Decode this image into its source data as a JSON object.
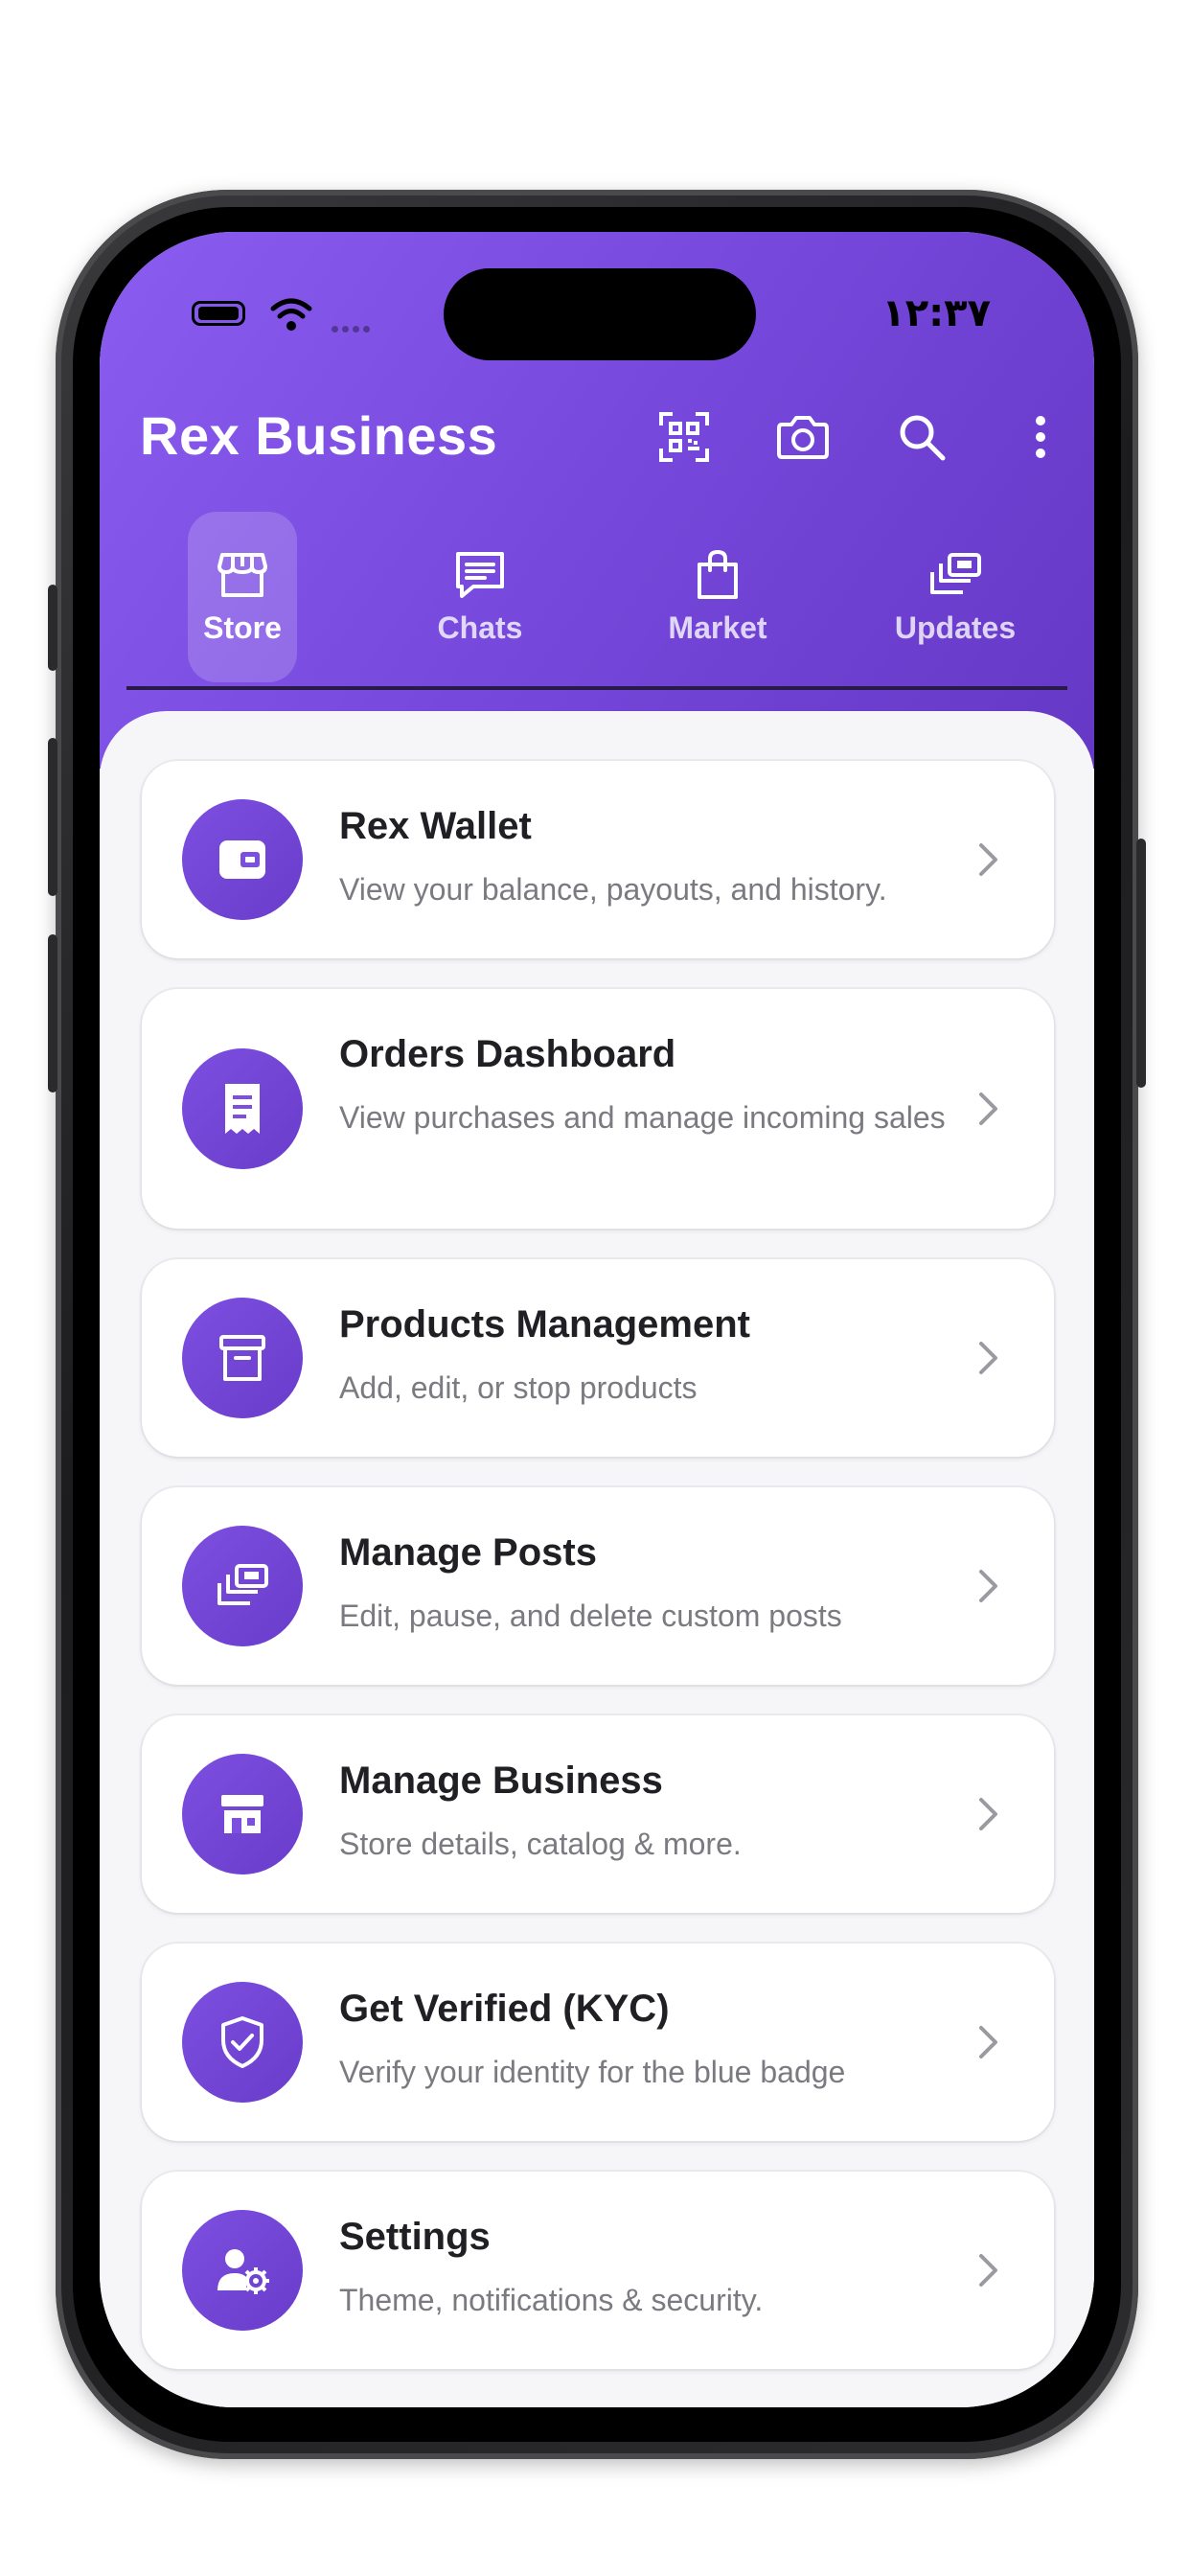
{
  "status": {
    "time": "١٢:٣٧"
  },
  "header": {
    "title": "Rex Business"
  },
  "tabs": [
    {
      "label": "Store",
      "icon": "store-icon"
    },
    {
      "label": "Chats",
      "icon": "chat-icon"
    },
    {
      "label": "Market",
      "icon": "shopping-bag-icon"
    },
    {
      "label": "Updates",
      "icon": "updates-icon"
    }
  ],
  "menu": [
    {
      "title": "Rex Wallet",
      "desc": "View your balance, payouts, and history.",
      "icon": "wallet-icon"
    },
    {
      "title": "Orders Dashboard",
      "desc": "View purchases and manage incoming sales",
      "icon": "receipt-icon"
    },
    {
      "title": "Products Management",
      "desc": "Add, edit, or stop products",
      "icon": "archive-box-icon"
    },
    {
      "title": "Manage Posts",
      "desc": "Edit, pause, and delete custom posts",
      "icon": "posts-icon"
    },
    {
      "title": "Manage Business",
      "desc": "Store details, catalog & more.",
      "icon": "storefront-icon"
    },
    {
      "title": "Get Verified (KYC)",
      "desc": "Verify your identity for the blue badge",
      "icon": "shield-check-icon"
    },
    {
      "title": "Settings",
      "desc": "Theme, notifications & security.",
      "icon": "user-settings-icon"
    }
  ],
  "colors": {
    "accent": "#7c4fe0",
    "header_gradient_start": "#8a5cf0",
    "header_gradient_end": "#6638c6"
  }
}
